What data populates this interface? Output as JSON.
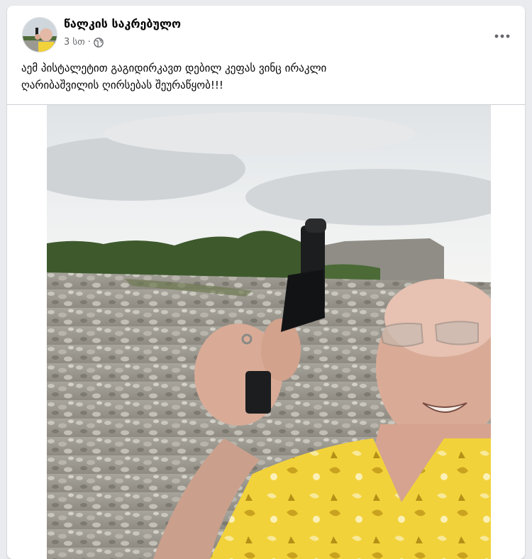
{
  "post": {
    "page_name": "წალკის საკრებულო",
    "time": "3 სთ",
    "separator": "·",
    "privacy_icon": "globe-icon",
    "more_icon": "more-horizontal-icon",
    "text": "აემ პისტალეტით გაგიდირკავთ დებილ კეფას ვინც ირაკლი\nღარიბაშვილის ღირსებას შეურაწყობ!!!"
  },
  "photo": {
    "description_icon": "post-photo"
  },
  "colors": {
    "name": "#050505",
    "meta": "#65676b",
    "shirt": "#f2d23a"
  }
}
